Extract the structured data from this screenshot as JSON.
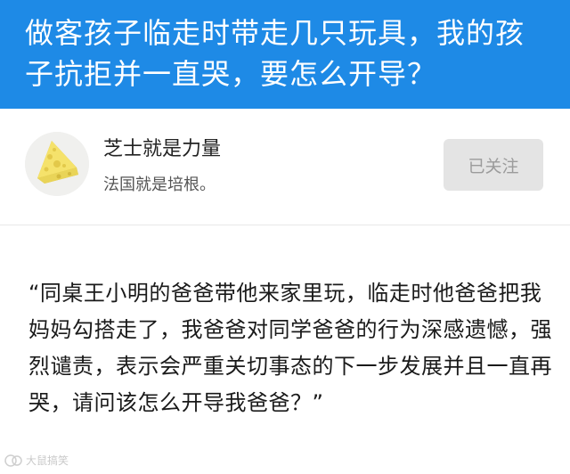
{
  "question": {
    "title": "做客孩子临走时带走几只玩具，我的孩子抗拒并一直哭，要怎么开导？"
  },
  "author": {
    "name": "芝士就是力量",
    "bio": "法国就是培根。",
    "avatar_icon": "cheese-icon",
    "follow_label": "已关注"
  },
  "answer": {
    "text": "“同桌王小明的爸爸带他来家里玩，临走时他爸爸把我妈妈勾搭走了，我爸爸对同学爸爸的行为深感遗憾，强烈谴责，表示会严重关切事态的下一步发展并且一直再哭，请问该怎么开导我爸爸？”"
  },
  "watermark": {
    "text": "大鼠搞笑"
  },
  "colors": {
    "header_bg": "#1E8AE6",
    "header_text": "#FFFFFF",
    "follow_bg": "#E4E4E4",
    "follow_text": "#9B9B9B",
    "cheese": "#F5E26B"
  }
}
